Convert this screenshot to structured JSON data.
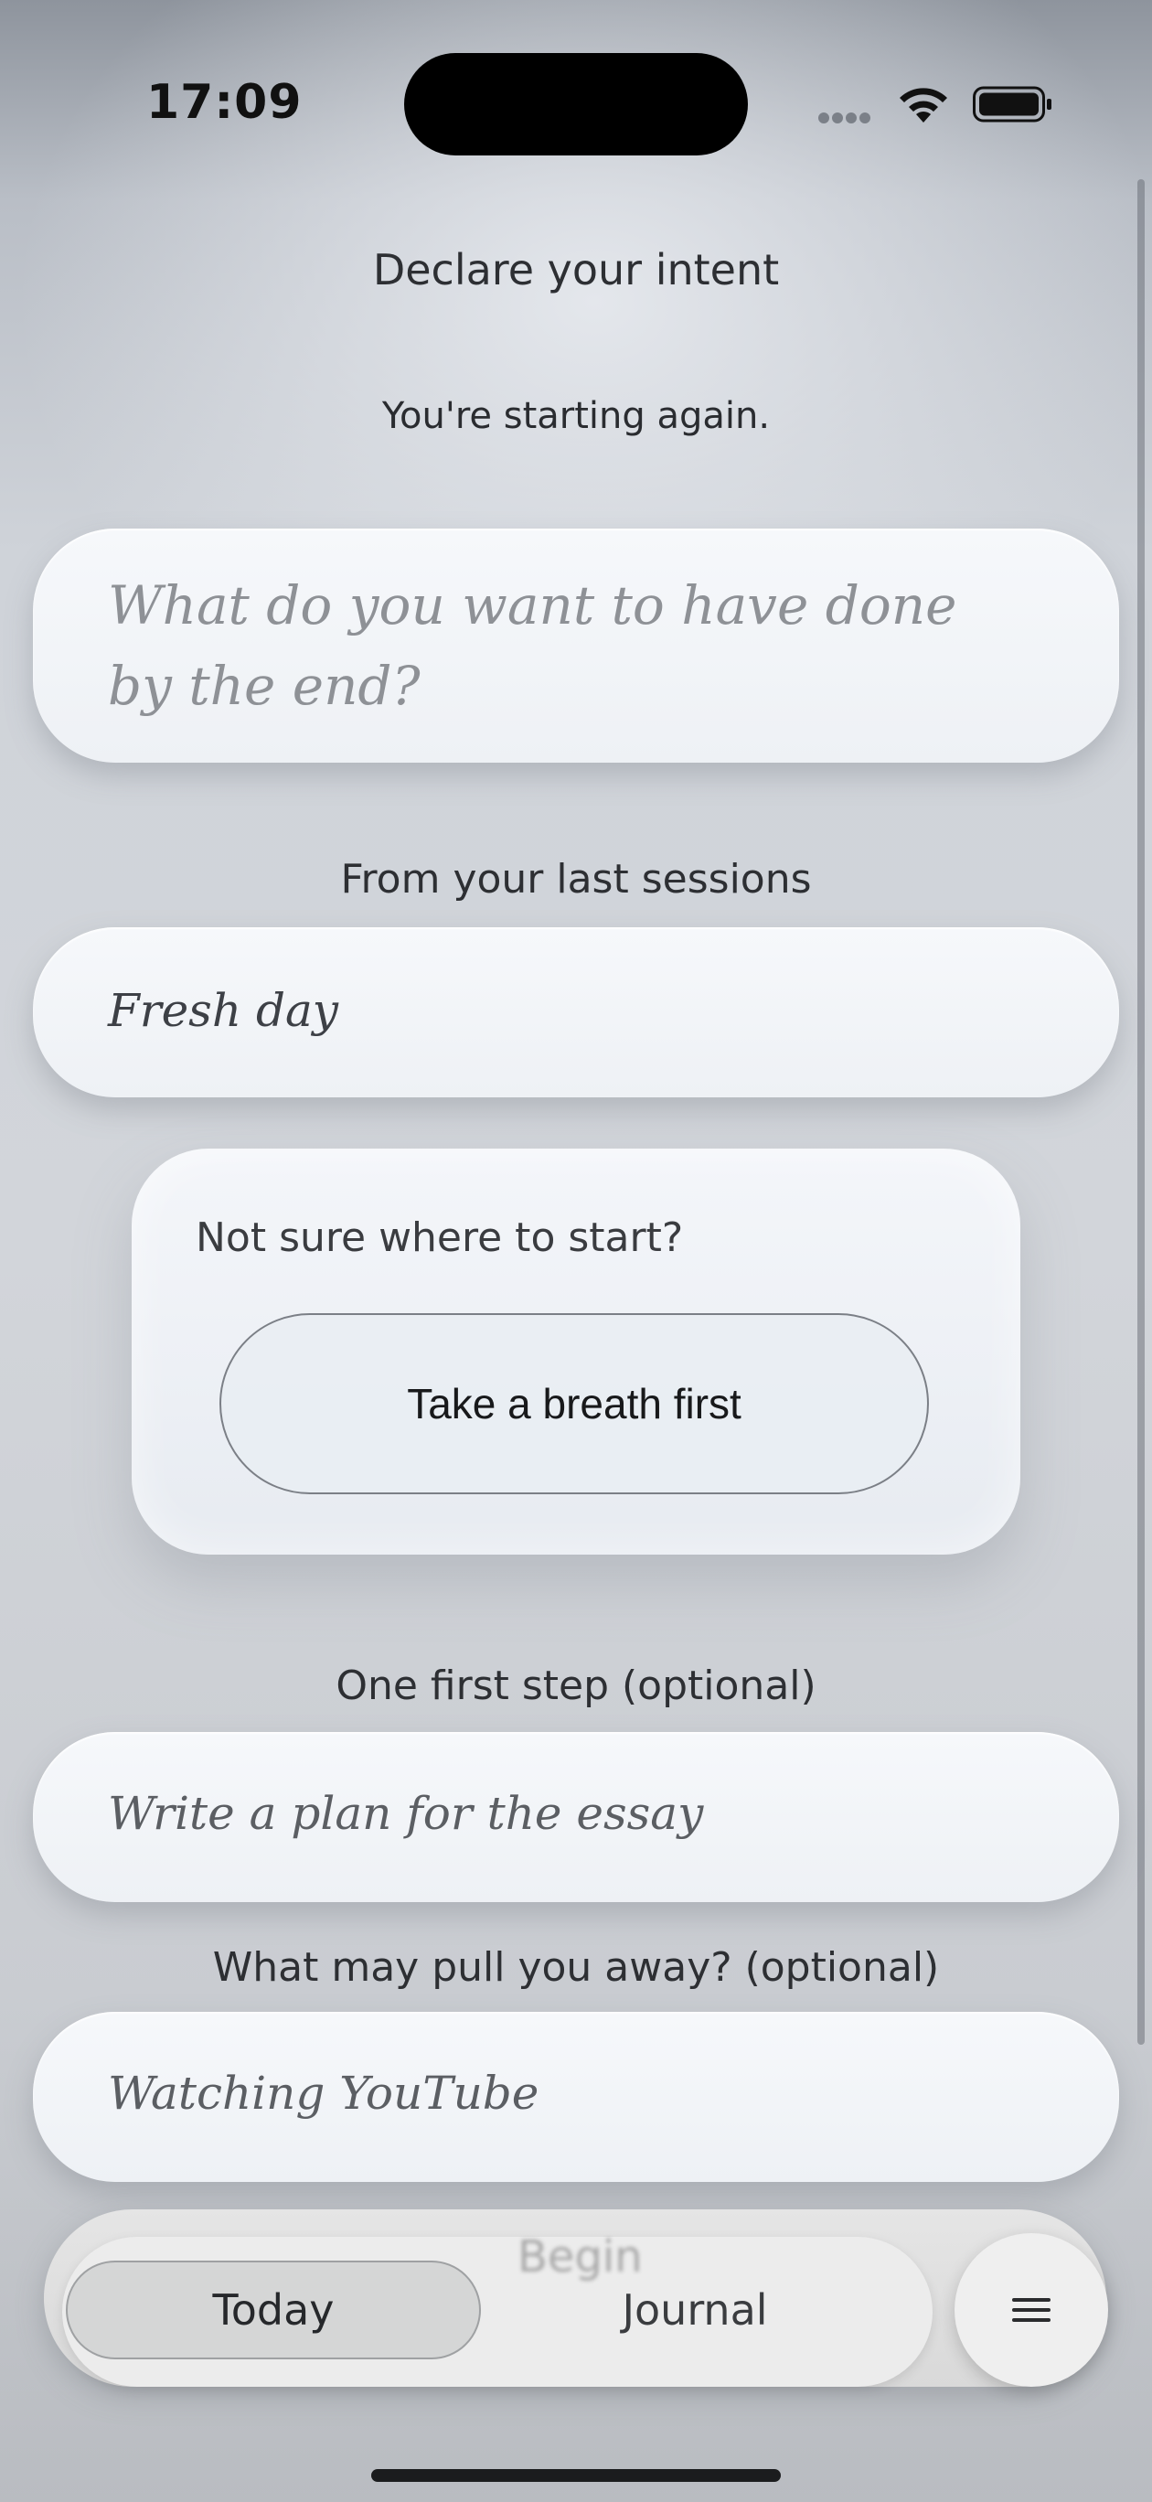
{
  "status_bar": {
    "time": "17:09"
  },
  "header": {
    "title": "Declare your intent",
    "subtitle": "You're starting again."
  },
  "intent_field": {
    "placeholder": "What do you want to have done by the end?"
  },
  "last_sessions": {
    "label": "From your last sessions",
    "value": "Fresh day"
  },
  "start_card": {
    "prompt": "Not sure where to start?",
    "button_label": "Take a breath first"
  },
  "first_step": {
    "label": "One first step (optional)",
    "placeholder": "Write a plan for the essay"
  },
  "distractions": {
    "label": "What may pull you away? (optional)",
    "placeholder": "Watching YouTube"
  },
  "tab_bar": {
    "tabs": [
      {
        "label": "Today",
        "selected": true
      },
      {
        "label": "Journal",
        "selected": false
      }
    ],
    "ghost_text": "Begin",
    "menu_icon": "hamburger-menu-icon"
  }
}
